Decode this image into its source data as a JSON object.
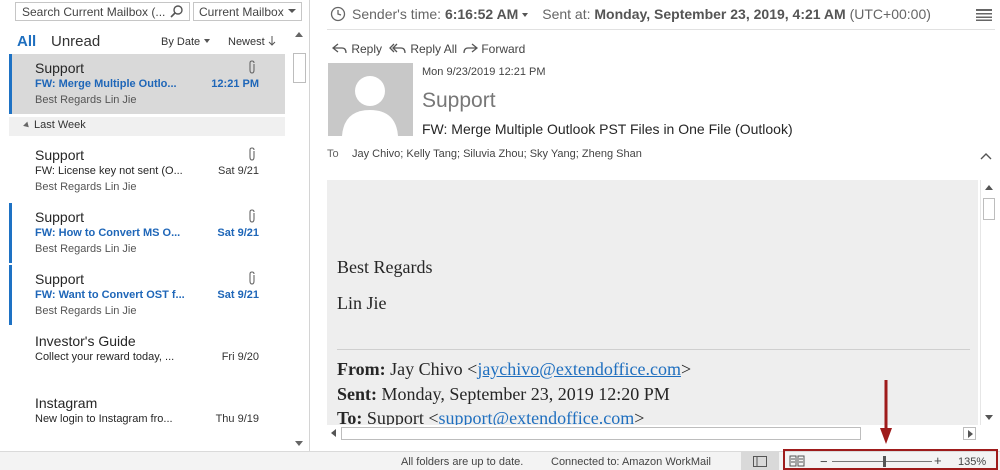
{
  "search": {
    "placeholder": "Search Current Mailbox (...",
    "scope": "Current Mailbox"
  },
  "filters": {
    "all": "All",
    "unread": "Unread",
    "sort": "By Date",
    "order": "Newest"
  },
  "group_header": "Last Week",
  "messages": [
    {
      "sender": "Support",
      "subject": "FW: Merge Multiple Outlo...",
      "preview": "Best Regards  Lin Jie",
      "date": "12:21 PM",
      "attachment": true,
      "unread": true,
      "selected": true
    },
    {
      "sender": "Support",
      "subject": "FW: License key not sent (O...",
      "preview": "Best Regards  Lin Jie",
      "date": "Sat 9/21",
      "attachment": true,
      "unread": false
    },
    {
      "sender": "Support",
      "subject": "FW: How to Convert MS O...",
      "preview": "Best Regards  Lin Jie",
      "date": "Sat 9/21",
      "attachment": true,
      "unread": true
    },
    {
      "sender": "Support",
      "subject": "FW: Want to Convert OST f...",
      "preview": "Best Regards  Lin Jie",
      "date": "Sat 9/21",
      "attachment": true,
      "unread": true
    },
    {
      "sender": "Investor's Guide",
      "subject": "Collect your reward today, ...",
      "preview": "",
      "date": "Fri 9/20",
      "attachment": false,
      "unread": false
    },
    {
      "sender": "Instagram",
      "subject": "New login to Instagram fro...",
      "preview": "",
      "date": "Thu 9/19",
      "attachment": false,
      "unread": false
    }
  ],
  "reading": {
    "senders_time_label": "Sender's time:",
    "senders_time": "6:16:52 AM",
    "sent_at_label": "Sent at:",
    "sent_at": "Monday, September 23, 2019, 4:21 AM",
    "timezone": "(UTC+00:00)",
    "actions": {
      "reply": "Reply",
      "reply_all": "Reply All",
      "forward": "Forward"
    },
    "date": "Mon 9/23/2019 12:21 PM",
    "sender": "Support",
    "subject": "FW: Merge Multiple Outlook PST Files in One File (Outlook)",
    "to_label": "To",
    "to": "Jay Chivo; Kelly Tang; Siluvia Zhou; Sky Yang; Zheng Shan"
  },
  "body": {
    "regards": "Best Regards",
    "name": "Lin Jie",
    "from_label": "From:",
    "from_name": "Jay Chivo <",
    "from_email": "jaychivo@extendoffice.com",
    "from_close": ">",
    "sent_label": "Sent:",
    "sent_value": "Monday, September 23, 2019 12:20 PM",
    "to_label": "To:",
    "to_name": "Support <",
    "to_email": "support@extendoffice.com",
    "to_close": ">"
  },
  "status": {
    "sync": "All folders are up to date.",
    "connection": "Connected to: Amazon WorkMail",
    "zoom": "135%"
  },
  "colors": {
    "accent": "#1e72c4",
    "highlight_box": "#9e1b1b"
  }
}
